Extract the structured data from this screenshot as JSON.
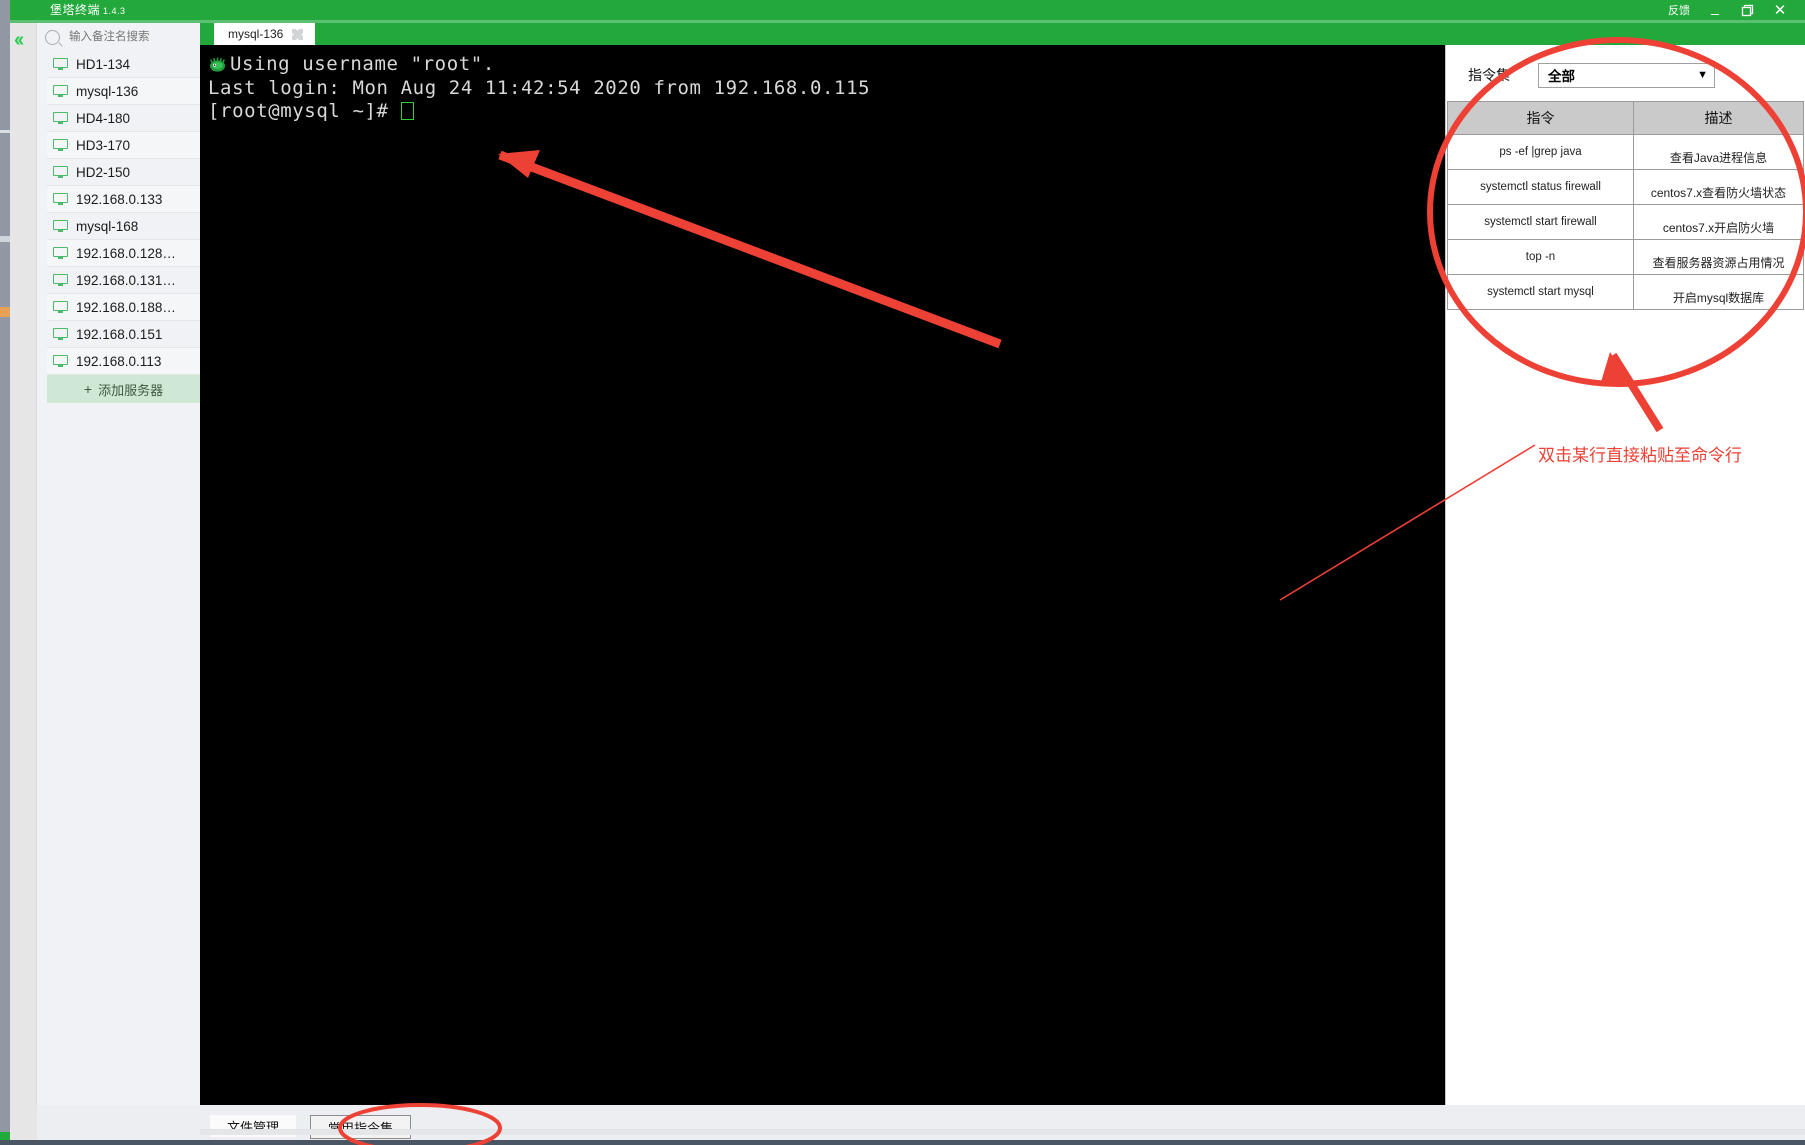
{
  "window": {
    "app_title": "堡塔终端",
    "version": "1.4.3",
    "feedback_label": "反馈",
    "minimize_icon": "minimize-icon",
    "restore_icon": "restore-icon",
    "close_icon": "close-icon"
  },
  "sidebar": {
    "collapse_icon": "double-chevron-left-icon",
    "search": {
      "placeholder": "输入备注名搜索",
      "value": "",
      "icon": "search-icon"
    },
    "servers": [
      {
        "label": "HD1-134",
        "icon": "monitor-icon"
      },
      {
        "label": "mysql-136",
        "icon": "monitor-icon"
      },
      {
        "label": "HD4-180",
        "icon": "monitor-icon"
      },
      {
        "label": "HD3-170",
        "icon": "monitor-icon"
      },
      {
        "label": "HD2-150",
        "icon": "monitor-icon"
      },
      {
        "label": "192.168.0.133",
        "icon": "monitor-icon"
      },
      {
        "label": "mysql-168",
        "icon": "monitor-icon"
      },
      {
        "label": "192.168.0.128…",
        "icon": "monitor-icon"
      },
      {
        "label": "192.168.0.131…",
        "icon": "monitor-icon"
      },
      {
        "label": "192.168.0.188…",
        "icon": "monitor-icon"
      },
      {
        "label": "192.168.0.151",
        "icon": "monitor-icon"
      },
      {
        "label": "192.168.0.113",
        "icon": "monitor-icon"
      }
    ],
    "add_server": {
      "label": "添加服务器",
      "plus": "+"
    }
  },
  "tabs": [
    {
      "label": "mysql-136",
      "close_icon": "close-tab-icon"
    }
  ],
  "terminal": {
    "logo_icon": "turtle-logo-icon",
    "line1": "Using username \"root\".",
    "line2": "Last login: Mon Aug 24 11:42:54 2020 from 192.168.0.115",
    "line3": "[root@mysql ~]# "
  },
  "command_panel": {
    "set_label": "指令集",
    "set_selected": "全部",
    "caret_icon": "chevron-down-icon",
    "columns": [
      "指令",
      "描述"
    ],
    "rows": [
      {
        "cmd": "ps -ef |grep java",
        "desc": "查看Java进程信息"
      },
      {
        "cmd": "systemctl status firewall",
        "desc": "centos7.x查看防火墙状态"
      },
      {
        "cmd": "systemctl start firewall",
        "desc": "centos7.x开启防火墙"
      },
      {
        "cmd": "top -n",
        "desc": "查看服务器资源占用情况"
      },
      {
        "cmd": "systemctl start mysql",
        "desc": "开启mysql数据库"
      }
    ]
  },
  "bottom_tabs": [
    {
      "label": "文件管理",
      "selected": false
    },
    {
      "label": "常用指令集",
      "selected": true
    }
  ],
  "annotation": {
    "text": "双击某行直接粘贴至命令行",
    "color": "#ee4136"
  },
  "colors": {
    "brand_green": "#23a83b",
    "sidebar_bg": "#f0f2f5",
    "terminal_bg": "#000000",
    "annotation_red": "#ee4136",
    "add_server_bg": "#cfe8d5"
  }
}
